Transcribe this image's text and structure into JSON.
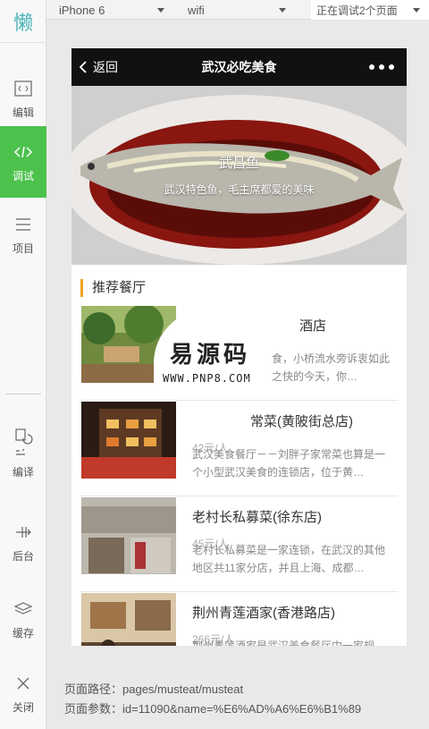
{
  "sidebar": {
    "logo": "懒",
    "items": [
      {
        "label": "编辑",
        "icon": "code-file-icon"
      },
      {
        "label": "调试",
        "icon": "code-icon"
      },
      {
        "label": "项目",
        "icon": "menu-icon"
      },
      {
        "label": "编译",
        "icon": "compile-icon"
      },
      {
        "label": "后台",
        "icon": "backend-icon"
      },
      {
        "label": "缓存",
        "icon": "layers-icon"
      },
      {
        "label": "关闭",
        "icon": "close-icon"
      }
    ]
  },
  "toolbar": {
    "device": "iPhone 6",
    "network": "wifi",
    "pages": "正在调试2个页面"
  },
  "app": {
    "back_label": "返回",
    "title": "武汉必吃美食",
    "banner": {
      "title": "武昌鱼",
      "subtitle": "武汉特色鱼，毛主席都爱的美味"
    },
    "section_title": "推荐餐厅",
    "restaurants": [
      {
        "name": "小桥流水酒店",
        "visible_name": "酒店",
        "price": "",
        "desc": "食，小桥流水旁诉衷如此之快的今天，你…"
      },
      {
        "name": "常菜(黄陂街总店)",
        "price": "42元/人",
        "desc": "武汉美食餐厅－－刘胖子家常菜也算是一个小型武汉美食的连锁店，位于黄…"
      },
      {
        "name": "老村长私募菜(徐东店)",
        "price": "45元/人",
        "desc": "老村长私募菜是一家连锁，在武汉的其他地区共11家分店，并且上海、成都…"
      },
      {
        "name": "荆州青莲酒家(香港路店)",
        "price": "266元/人",
        "desc": "荆州青莲酒家是武汉美食餐厅中一家规…"
      }
    ]
  },
  "watermark": {
    "main": "易源码",
    "sub": "WWW.PNP8.COM"
  },
  "footer": {
    "path": "页面路径：pages/musteat/musteat",
    "params": "页面参数：id=11090&name=%E6%AD%A6%E6%B1%89"
  },
  "colors": {
    "accent_green": "#4cc24c",
    "logo_teal": "#4cb5b8",
    "section_bar": "#f0a020",
    "navbar_bg": "#111111"
  }
}
